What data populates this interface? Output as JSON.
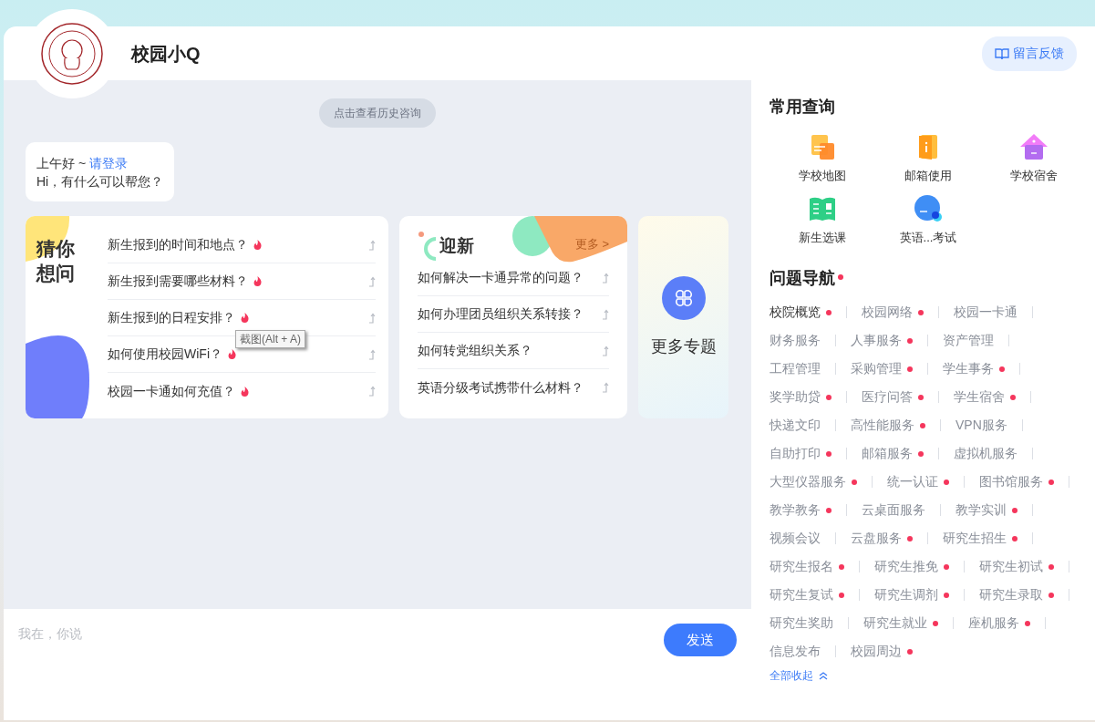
{
  "header": {
    "title": "校园小Q",
    "feedback_button": "留言反馈"
  },
  "chat": {
    "history_button": "点击查看历史咨询",
    "greeting": {
      "salutation": "上午好 ~",
      "login_link": "请登录",
      "question": "Hi，有什么可以帮您？"
    },
    "guess_card": {
      "title": "猜你想问",
      "questions": [
        {
          "text": "新生报到的时间和地点？",
          "hot": true
        },
        {
          "text": "新生报到需要哪些材料？",
          "hot": true
        },
        {
          "text": "新生报到的日程安排？",
          "hot": true
        },
        {
          "text": "如何使用校园WiFi？",
          "hot": true
        },
        {
          "text": "校园一卡通如何充值？",
          "hot": true
        }
      ]
    },
    "tooltip": "截图(Alt + A)",
    "welcome_card": {
      "title": "迎新",
      "more_link": "更多 >",
      "questions": [
        {
          "text": "如何解决一卡通异常的问题？",
          "hot": false
        },
        {
          "text": "如何办理团员组织关系转接？",
          "hot": false
        },
        {
          "text": "如何转党组织关系？",
          "hot": false
        },
        {
          "text": "英语分级考试携带什么材料？",
          "hot": false
        }
      ]
    },
    "more_topics": "更多专题",
    "input": {
      "placeholder": "我在，你说"
    },
    "send_button": "发送"
  },
  "sidebar": {
    "quick_title": "常用查询",
    "quick_links": [
      {
        "label": "学校地图",
        "kind": "map"
      },
      {
        "label": "邮箱使用",
        "kind": "mail"
      },
      {
        "label": "学校宿舍",
        "kind": "dorm"
      },
      {
        "label": "新生选课",
        "kind": "book"
      },
      {
        "label": "英语...考试",
        "kind": "cet"
      }
    ],
    "nav_title": "问题导航",
    "nav_title_dot": true,
    "nav_rows": [
      [
        {
          "label": "校院概览",
          "hot": true,
          "selected": true
        },
        {
          "label": "校园网络",
          "hot": true,
          "selected": false
        },
        {
          "label": "校园一卡通",
          "hot": false,
          "selected": false
        }
      ],
      [
        {
          "label": "财务服务",
          "hot": false,
          "selected": false
        },
        {
          "label": "人事服务",
          "hot": true,
          "selected": false
        },
        {
          "label": "资产管理",
          "hot": false,
          "selected": false
        }
      ],
      [
        {
          "label": "工程管理",
          "hot": false,
          "selected": false
        },
        {
          "label": "采购管理",
          "hot": true,
          "selected": false
        },
        {
          "label": "学生事务",
          "hot": true,
          "selected": false
        }
      ],
      [
        {
          "label": "奖学助贷",
          "hot": true,
          "selected": false
        },
        {
          "label": "医疗问答",
          "hot": true,
          "selected": false
        },
        {
          "label": "学生宿舍",
          "hot": true,
          "selected": false
        }
      ],
      [
        {
          "label": "快递文印",
          "hot": false,
          "selected": false
        },
        {
          "label": "高性能服务",
          "hot": true,
          "selected": false
        },
        {
          "label": "VPN服务",
          "hot": false,
          "selected": false
        }
      ],
      [
        {
          "label": "自助打印",
          "hot": true,
          "selected": false
        },
        {
          "label": "邮箱服务",
          "hot": true,
          "selected": false
        },
        {
          "label": "虚拟机服务",
          "hot": false,
          "selected": false
        }
      ],
      [
        {
          "label": "大型仪器服务",
          "hot": true,
          "selected": false
        },
        {
          "label": "统一认证",
          "hot": true,
          "selected": false
        },
        {
          "label": "图书馆服务",
          "hot": true,
          "selected": false
        }
      ],
      [
        {
          "label": "教学教务",
          "hot": true,
          "selected": false
        },
        {
          "label": "云桌面服务",
          "hot": false,
          "selected": false
        },
        {
          "label": "教学实训",
          "hot": true,
          "selected": false
        }
      ],
      [
        {
          "label": "视频会议",
          "hot": false,
          "selected": false
        },
        {
          "label": "云盘服务",
          "hot": true,
          "selected": false
        },
        {
          "label": "研究生招生",
          "hot": true,
          "selected": false
        }
      ],
      [
        {
          "label": "研究生报名",
          "hot": true,
          "selected": false
        },
        {
          "label": "研究生推免",
          "hot": true,
          "selected": false
        },
        {
          "label": "研究生初试",
          "hot": true,
          "selected": false
        }
      ],
      [
        {
          "label": "研究生复试",
          "hot": true,
          "selected": false
        },
        {
          "label": "研究生调剂",
          "hot": true,
          "selected": false
        },
        {
          "label": "研究生录取",
          "hot": true,
          "selected": false
        }
      ],
      [
        {
          "label": "研究生奖助",
          "hot": false,
          "selected": false
        },
        {
          "label": "研究生就业",
          "hot": true,
          "selected": false
        },
        {
          "label": "座机服务",
          "hot": true,
          "selected": false
        }
      ],
      [
        {
          "label": "信息发布",
          "hot": false,
          "selected": false
        },
        {
          "label": "校园周边",
          "hot": true,
          "selected": false
        }
      ]
    ],
    "collapse_link": "全部收起"
  }
}
